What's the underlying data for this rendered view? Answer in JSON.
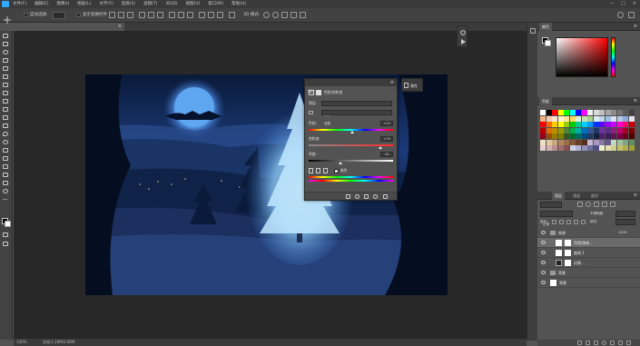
{
  "menu": {
    "items": [
      "文件(F)",
      "编辑(E)",
      "图像(I)",
      "图层(L)",
      "文字(Y)",
      "选择(S)",
      "滤镜(T)",
      "3D(D)",
      "视图(V)",
      "窗口(W)",
      "帮助(H)"
    ],
    "window_controls": [
      "—",
      "□",
      "✕"
    ]
  },
  "options": {
    "auto_select_label": "自动选择:",
    "auto_select_value": "组",
    "transform_label": "显示变换控件",
    "mode_3d": "3D 模式:"
  },
  "document_tab": {
    "title": "圣诞风景照.psd @ 100% (色相/饱和度1, 图层蒙版/8) *"
  },
  "status": {
    "zoom": "100%",
    "doc_info": "文档:1.20M/3.66M"
  },
  "properties": {
    "title": "属性",
    "adjustment_name": "色相/饱和度",
    "preset_label": "预设:",
    "preset_value": "默认",
    "channel_value": "全图",
    "hue_label": "色相:",
    "hue_value": "+17",
    "saturation_label": "饱和度:",
    "saturation_value": "+75",
    "lightness_label": "明度:",
    "lightness_value": "-31",
    "colorize_label": "着色",
    "hue_position": 0.52,
    "saturation_position": 0.85,
    "lightness_position": 0.38,
    "collapsed_label": "属性"
  },
  "color_panel": {
    "tab_color": "颜色",
    "menu_icon": "≡",
    "foreground": "#000000",
    "background": "#ffffff"
  },
  "swatches_panel": {
    "tab_swatches": "色板",
    "colors": [
      "#ffffff",
      "#000000",
      "#ff0000",
      "#ffff00",
      "#00ff00",
      "#00ffff",
      "#0000ff",
      "#ff00ff",
      "#f2f2f2",
      "#d9d9d9",
      "#bfbfbf",
      "#a6a6a6",
      "#8c8c8c",
      "#737373",
      "#595959",
      "#404040",
      "#f4b183",
      "#f8cbad",
      "#fbe5d6",
      "#fff2cc",
      "#ffe699",
      "#ffd966",
      "#e2efda",
      "#c6e0b4",
      "#a9d08e",
      "#ddebf7",
      "#bdd7ee",
      "#9bc2e6",
      "#d9e1f2",
      "#b4c6e7",
      "#8ea9db",
      "#e4dfec",
      "#ff0000",
      "#ff6600",
      "#ffcc00",
      "#ffff00",
      "#99cc00",
      "#00cc00",
      "#00cc99",
      "#00ccff",
      "#0099ff",
      "#0033ff",
      "#6600ff",
      "#9900ff",
      "#cc00ff",
      "#ff00cc",
      "#ff0066",
      "#cc0000",
      "#c00000",
      "#e26b0a",
      "#bf8f00",
      "#9c9c00",
      "#548235",
      "#00b050",
      "#00b0a0",
      "#0070c0",
      "#2f5597",
      "#203864",
      "#7030a0",
      "#5b2c83",
      "#8e1f7c",
      "#c0006e",
      "#a50021",
      "#7f0000",
      "#99001a",
      "#994d00",
      "#997a00",
      "#7f7f00",
      "#375623",
      "#006b2e",
      "#006b5e",
      "#004a80",
      "#1f3864",
      "#141f3c",
      "#4b206b",
      "#3d1d58",
      "#5e1452",
      "#7d0048",
      "#6b0015",
      "#4d0000",
      "#f0e0c0",
      "#e0c8a0",
      "#c8a878",
      "#b08860",
      "#987048",
      "#805838",
      "#684028",
      "#503018",
      "#c8b8d8",
      "#a898c0",
      "#8878a8",
      "#685890",
      "#c0d8c0",
      "#a0c0a0",
      "#80a880",
      "#609060",
      "#e8d0d0",
      "#d0b0b0",
      "#b89090",
      "#a07070",
      "#885050",
      "#d0d0e8",
      "#b0b0d0",
      "#9090b8",
      "#7070a0",
      "#505088",
      "#f0f0d0",
      "#e0e0b0",
      "#d0d090",
      "#c0c070",
      "#b0b050",
      "#a0a030"
    ]
  },
  "layers_panel": {
    "tab_layers": "图层",
    "tab_channels": "通道",
    "tab_paths": "路径",
    "kind_filter": "类型",
    "blend_mode": "正常",
    "opacity_label": "不透明度:",
    "opacity_value": "100%",
    "lock_label": "锁定:",
    "fill_label": "填充:",
    "fill_value": "100%",
    "layers": [
      {
        "name": "效果",
        "type": "group"
      },
      {
        "name": "色相/饱和...",
        "type": "adjustment"
      },
      {
        "name": "曲线 1",
        "type": "adjustment"
      },
      {
        "name": "风景...",
        "type": "image"
      },
      {
        "name": "背景",
        "type": "group"
      },
      {
        "name": "背景",
        "type": "fill"
      }
    ]
  }
}
